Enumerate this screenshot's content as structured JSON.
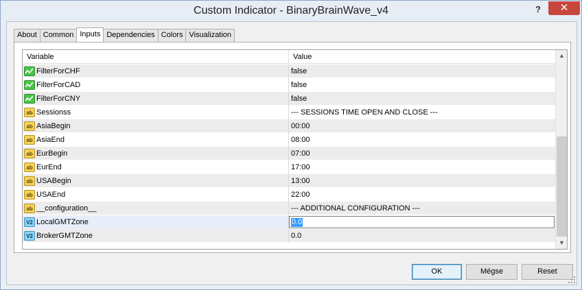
{
  "window": {
    "title": "Custom Indicator - BinaryBrainWave_v4",
    "help_label": "?",
    "close_label": "✕"
  },
  "tabs": [
    {
      "label": "About"
    },
    {
      "label": "Common"
    },
    {
      "label": "Inputs",
      "active": true
    },
    {
      "label": "Dependencies"
    },
    {
      "label": "Colors"
    },
    {
      "label": "Visualization"
    }
  ],
  "grid": {
    "columns": {
      "variable": "Variable",
      "value": "Value"
    },
    "rows": [
      {
        "type": "bool",
        "icon": "bool-param-icon",
        "variable": "FilterForCHF",
        "value": "false"
      },
      {
        "type": "bool",
        "icon": "bool-param-icon",
        "variable": "FilterForCAD",
        "value": "false"
      },
      {
        "type": "bool",
        "icon": "bool-param-icon",
        "variable": "FilterForCNY",
        "value": "false"
      },
      {
        "type": "string",
        "icon": "string-param-icon",
        "icon_text": "ab",
        "variable": "Sessionss",
        "value": "--- SESSIONS TIME OPEN AND CLOSE ---"
      },
      {
        "type": "string",
        "icon": "string-param-icon",
        "icon_text": "ab",
        "variable": "AsiaBegin",
        "value": "00:00"
      },
      {
        "type": "string",
        "icon": "string-param-icon",
        "icon_text": "ab",
        "variable": "AsiaEnd",
        "value": "08:00"
      },
      {
        "type": "string",
        "icon": "string-param-icon",
        "icon_text": "ab",
        "variable": "EurBegin",
        "value": "07:00"
      },
      {
        "type": "string",
        "icon": "string-param-icon",
        "icon_text": "ab",
        "variable": "EurEnd",
        "value": "17:00"
      },
      {
        "type": "string",
        "icon": "string-param-icon",
        "icon_text": "ab",
        "variable": "USABegin",
        "value": "13:00"
      },
      {
        "type": "string",
        "icon": "string-param-icon",
        "icon_text": "ab",
        "variable": "USAEnd",
        "value": "22:00"
      },
      {
        "type": "string",
        "icon": "string-param-icon",
        "icon_text": "ab",
        "variable": "__configuration__",
        "value": "--- ADDITIONAL CONFIGURATION ---"
      },
      {
        "type": "double",
        "icon": "double-param-icon",
        "icon_text": "V2",
        "variable": "LocalGMTZone",
        "value": "0.0",
        "editing": true
      },
      {
        "type": "double",
        "icon": "double-param-icon",
        "icon_text": "V2",
        "variable": "BrokerGMTZone",
        "value": "0.0"
      }
    ]
  },
  "buttons": {
    "ok": "OK",
    "cancel": "Mégse",
    "reset": "Reset"
  },
  "scrollbar": {
    "up_arrow": "▲",
    "down_arrow": "▼"
  }
}
